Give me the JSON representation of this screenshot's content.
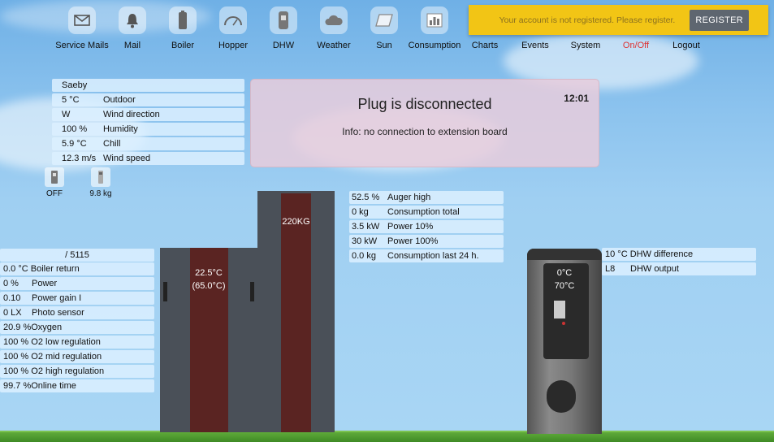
{
  "nav": {
    "items": [
      {
        "label": "Service Mails",
        "icon": "envelope-icon"
      },
      {
        "label": "Mail",
        "icon": "bell-icon"
      },
      {
        "label": "Boiler",
        "icon": "boiler-icon"
      },
      {
        "label": "Hopper",
        "icon": "gauge-icon"
      },
      {
        "label": "DHW",
        "icon": "water-tank-icon"
      },
      {
        "label": "Weather",
        "icon": "cloud-icon"
      },
      {
        "label": "Sun",
        "icon": "solar-panel-icon"
      },
      {
        "label": "Consumption",
        "icon": "bar-chart-icon"
      },
      {
        "label": "Charts"
      },
      {
        "label": "Events"
      },
      {
        "label": "System"
      },
      {
        "label": "On/Off",
        "active": true
      },
      {
        "label": "Logout"
      }
    ]
  },
  "banner": {
    "text": "Your account is not registered. Please register.",
    "button": "REGISTER"
  },
  "weather": {
    "location": "Saeby",
    "rows": [
      {
        "value": "5 °C",
        "label": "Outdoor"
      },
      {
        "value": "W",
        "label": "Wind direction"
      },
      {
        "value": "100 %",
        "label": "Humidity"
      },
      {
        "value": "5.9 °C",
        "label": "Chill"
      },
      {
        "value": "12.3 m/s",
        "label": "Wind speed"
      }
    ]
  },
  "message": {
    "title": "Plug is disconnected",
    "time": "12:01",
    "info": "Info: no connection to extension board"
  },
  "devices": {
    "switch_status": "OFF",
    "scale_weight": "9.8 kg"
  },
  "boiler": {
    "header": "/ 5115",
    "rows": [
      {
        "value": "0.0 °C",
        "label": "Boiler return"
      },
      {
        "value": "0 %",
        "label": "Power"
      },
      {
        "value": "0.10",
        "label": "Power gain I"
      },
      {
        "value": "0 LX",
        "label": "Photo sensor"
      },
      {
        "value": "20.9 %",
        "label": "Oxygen"
      },
      {
        "value": "100 %",
        "label": "O2 low regulation"
      },
      {
        "value": "100 %",
        "label": "O2 mid regulation"
      },
      {
        "value": "100 %",
        "label": "O2 high regulation"
      },
      {
        "value": "99.7 %",
        "label": "Online time"
      }
    ],
    "temp": "22.5°C",
    "setpoint": "(65.0°C)"
  },
  "hopper": {
    "level": "220KG",
    "rows": [
      {
        "value": "52.5 %",
        "label": "Auger high"
      },
      {
        "value": "0 kg",
        "label": "Consumption total"
      },
      {
        "value": "3.5 kW",
        "label": "Power 10%"
      },
      {
        "value": "30 kW",
        "label": "Power 100%"
      },
      {
        "value": "0.0 kg",
        "label": "Consumption last 24 h."
      }
    ]
  },
  "dhw": {
    "temp": "0°C",
    "setpoint": "70°C",
    "rows": [
      {
        "value": "10 °C",
        "label": "DHW difference"
      },
      {
        "value": "L8",
        "label": "DHW output"
      }
    ]
  }
}
